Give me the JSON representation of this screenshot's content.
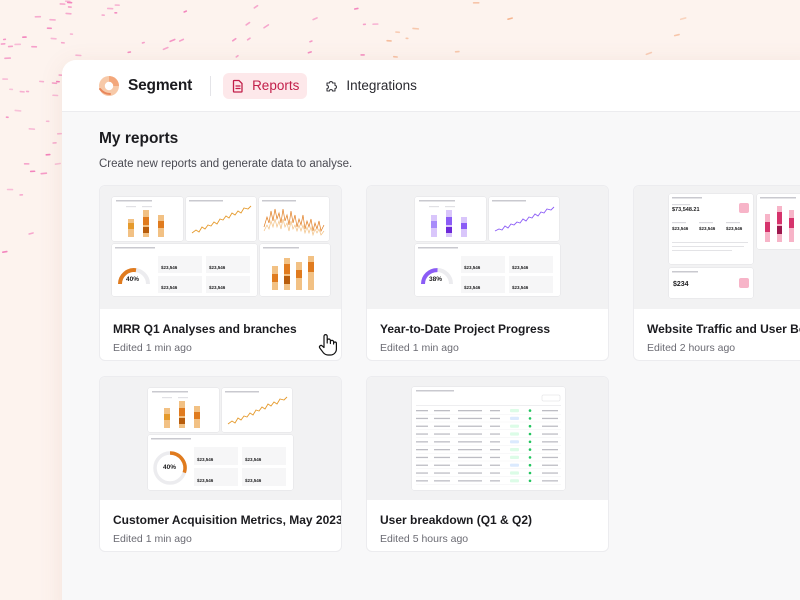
{
  "app": {
    "name": "Segment"
  },
  "nav": [
    {
      "label": "Reports",
      "icon": "document-icon",
      "active": true
    },
    {
      "label": "Integrations",
      "icon": "puzzle-icon",
      "active": false
    }
  ],
  "page": {
    "title": "My reports",
    "subtitle": "Create new reports and generate data to analyse."
  },
  "reports": [
    {
      "title": "MRR Q1 Analyses and branches",
      "meta": "Edited 1 min ago",
      "gauge": "40%",
      "accent": "#e07b1e"
    },
    {
      "title": "Year-to-Date Project Progress",
      "meta": "Edited 1 min ago",
      "gauge": "38%",
      "accent": "#8b5cf6"
    },
    {
      "title": "Website Traffic and User Behaviour",
      "meta": "Edited 2 hours ago",
      "stat_a": "$73,548.21",
      "stat_b": "$234",
      "accent": "#d6336c"
    },
    {
      "title": "Customer Acquisition Metrics, May 2023",
      "meta": "Edited 1 min ago",
      "gauge": "40%",
      "accent": "#e07b1e"
    },
    {
      "title": "User breakdown (Q1 & Q2)",
      "meta": "Edited 5 hours ago",
      "accent": "#16a34a"
    }
  ],
  "thumb_values": {
    "stat": "$23,546"
  },
  "colors": {
    "accent": "#c21f4a",
    "accent_bg": "#fde8ea",
    "orange": "#e07b1e",
    "purple": "#8b5cf6",
    "pink": "#d6336c"
  }
}
